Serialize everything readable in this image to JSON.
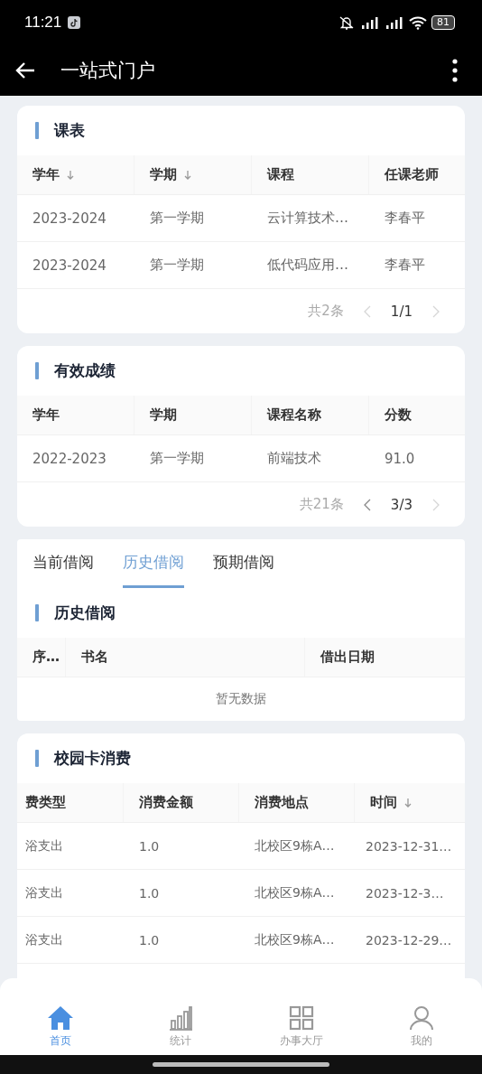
{
  "status_bar": {
    "time": "11:21",
    "battery": "81"
  },
  "app_bar": {
    "title": "一站式门户"
  },
  "timetable": {
    "title": "课表",
    "columns": [
      {
        "label": "学年",
        "sortable": true
      },
      {
        "label": "学期",
        "sortable": true
      },
      {
        "label": "课程",
        "sortable": false
      },
      {
        "label": "任课老师",
        "sortable": false
      }
    ],
    "rows": [
      [
        "2023-2024",
        "第一学期",
        "云计算技术…",
        "李春平"
      ],
      [
        "2023-2024",
        "第一学期",
        "低代码应用…",
        "李春平"
      ]
    ],
    "pagination": {
      "total": "共2条",
      "page": "1/1",
      "prev_disabled": true,
      "next_disabled": true
    }
  },
  "grades": {
    "title": "有效成绩",
    "columns": [
      {
        "label": "学年",
        "sortable": false
      },
      {
        "label": "学期",
        "sortable": false
      },
      {
        "label": "课程名称",
        "sortable": false
      },
      {
        "label": "分数",
        "sortable": false
      }
    ],
    "rows": [
      [
        "2022-2023",
        "第一学期",
        "前端技术",
        "91.0"
      ]
    ],
    "pagination": {
      "total": "共21条",
      "page": "3/3",
      "prev_disabled": false,
      "next_disabled": true
    }
  },
  "library": {
    "tabs": [
      {
        "label": "当前借阅",
        "selected": false
      },
      {
        "label": "历史借阅",
        "selected": true
      },
      {
        "label": "预期借阅",
        "selected": false
      }
    ],
    "title": "历史借阅",
    "columns": [
      {
        "label": "序…"
      },
      {
        "label": "书名"
      },
      {
        "label": "借出日期"
      }
    ],
    "empty": "暂无数据"
  },
  "card_spending": {
    "title": "校园卡消费",
    "columns": [
      {
        "label": "费类型",
        "sortable": false
      },
      {
        "label": "消费金额",
        "sortable": false
      },
      {
        "label": "消费地点",
        "sortable": false
      },
      {
        "label": "时间",
        "sortable": true
      }
    ],
    "rows": [
      [
        "浴支出",
        "1.0",
        "北校区9栋A…",
        "2023-12-31…"
      ],
      [
        "浴支出",
        "1.0",
        "北校区9栋A…",
        "2023-12-3…"
      ],
      [
        "浴支出",
        "1.0",
        "北校区9栋A…",
        "2023-12-29…"
      ]
    ]
  },
  "bottom_nav": [
    {
      "label": "首页",
      "kind": "home",
      "selected": true
    },
    {
      "label": "统计",
      "kind": "chart",
      "selected": false
    },
    {
      "label": "办事大厅",
      "kind": "grid",
      "selected": false
    },
    {
      "label": "我的",
      "kind": "person",
      "selected": false
    }
  ]
}
